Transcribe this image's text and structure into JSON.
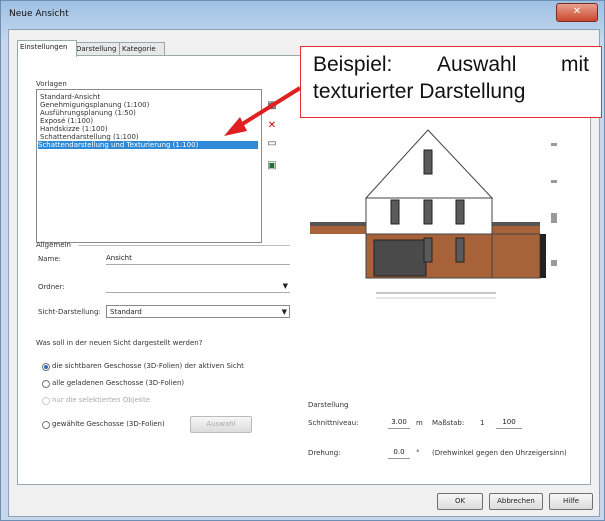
{
  "window": {
    "title": "Neue Ansicht",
    "close": "✕"
  },
  "tabs": [
    "Einstellungen",
    "Darstellung",
    "Kategorie"
  ],
  "vorlagen": {
    "label": "Vorlagen",
    "items": [
      "Standard-Ansicht",
      "Genehmigungsplanung (1:100)",
      "Ausführungsplanung (1:50)",
      "Exposé (1:100)",
      "Handskizze (1:100)",
      "Schattendarstellung (1:100)",
      "Schattendarstellung und Texturierung (1:100)"
    ],
    "selected_index": 6
  },
  "allgemein": {
    "label": "Allgemein",
    "name_label": "Name:",
    "name_value": "Ansicht",
    "ordner_label": "Ordner:",
    "sicht_label": "Sicht-Darstellung:",
    "sicht_value": "Standard"
  },
  "question": "Was soll in der neuen Sicht dargestellt werden?",
  "options": [
    {
      "label": "die sichtbaren Geschosse (3D-Folien) der aktiven Sicht",
      "selected": true
    },
    {
      "label": "alle geladenen Geschosse (3D-Folien)",
      "selected": false
    },
    {
      "label": "nur die selektierten Objekte",
      "selected": false,
      "disabled": true
    },
    {
      "label": "gewählte Geschosse (3D-Folien)",
      "selected": false
    }
  ],
  "auswahl_button": "Auswahl",
  "darstellung": {
    "label": "Darstellung",
    "schnitt_label": "Schnittniveau:",
    "schnitt_value": "3.00",
    "schnitt_unit": "m",
    "massstab_label": "Maßstab:",
    "massstab_left": "1",
    "massstab_right": "100",
    "drehung_label": "Drehung:",
    "drehung_value": "0.0",
    "drehung_unit": "°",
    "drehung_hint": "(Drehwinkel gegen den Uhrzeigersinn)"
  },
  "footer": {
    "ok": "OK",
    "abbrechen": "Abbrechen",
    "hilfe": "Hilfe"
  },
  "callout": {
    "line1_a": "Beispiel:",
    "line1_b": "Auswahl",
    "line1_c": "mit",
    "line2": "texturierter Darstellung"
  },
  "colors": {
    "selection": "#2e89d6",
    "arrow": "#e02020",
    "brick": "#a8623a"
  }
}
